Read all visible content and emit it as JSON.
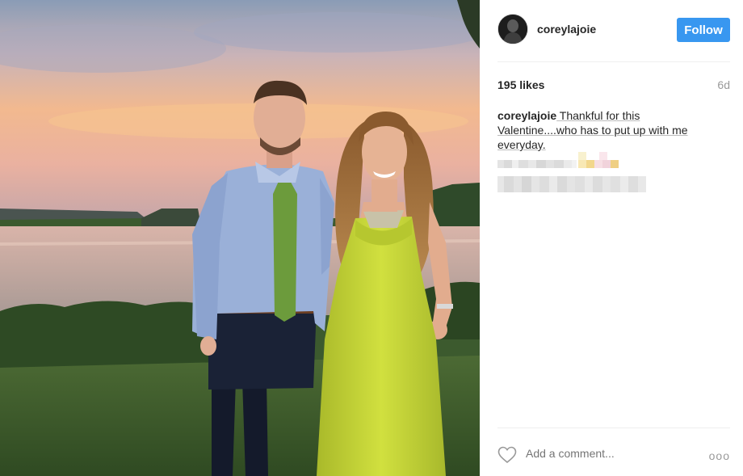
{
  "post": {
    "username": "coreylajoie",
    "follow_label": "Follow",
    "likes": "195 likes",
    "age": "6d",
    "caption": {
      "user": "coreylajoie",
      "text": " Thankful for this Valentine....who has to put up with me everyday."
    },
    "comment_placeholder": "Add a comment...",
    "more_label": "ooo"
  },
  "colors": {
    "follow_button": "#3897f0",
    "divider": "#efefef",
    "muted_text": "#999999",
    "dress": "#c7d83a"
  },
  "icons": {
    "like": "heart-outline-icon",
    "more": "more-options-icon"
  }
}
